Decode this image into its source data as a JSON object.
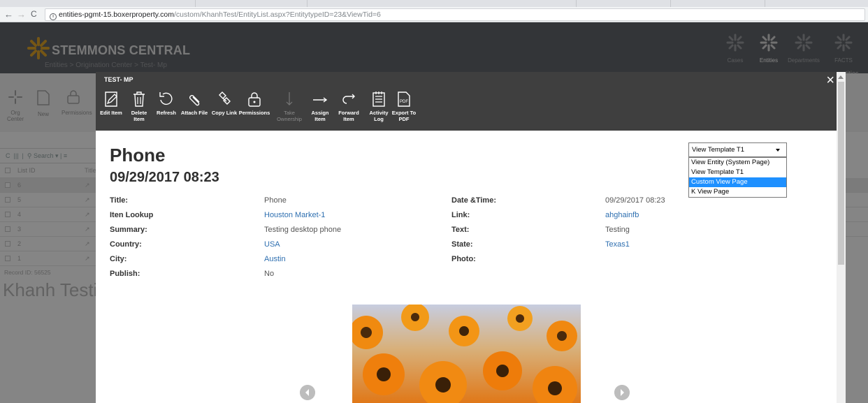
{
  "browser": {
    "url_host": "entities-pgmt-15.boxerproperty.com",
    "url_path": "/custom/KhanhTest/EntityList.aspx?EntitytypeID=23&ViewTid=6"
  },
  "app": {
    "brand": "STEMMONS CENTRAL",
    "breadcrumb": [
      "Entities",
      "Origination Center",
      "Test- Mp"
    ],
    "header_icons": [
      "Cases",
      "Entities",
      "Departments",
      "FACTS"
    ],
    "toolbar": [
      "Org Center",
      "New",
      "Permissions"
    ],
    "list_header": [
      "List ID",
      "Title"
    ],
    "list_search": "Search",
    "rows": [
      "6",
      "5",
      "4",
      "3",
      "2",
      "1"
    ],
    "record_id": "Record ID: 56525",
    "page_title": "Khanh Testi",
    "right_tab": "tities"
  },
  "modal": {
    "title": "TEST- MP",
    "buttons": [
      {
        "icon": "edit-icon",
        "label": "Edit Item"
      },
      {
        "icon": "trash-icon",
        "label": "Delete Item"
      },
      {
        "icon": "refresh-icon",
        "label": "Refresh"
      },
      {
        "icon": "paperclip-icon",
        "label": "Attach File"
      },
      {
        "icon": "link-icon",
        "label": "Copy Link"
      },
      {
        "icon": "lock-icon",
        "label": "Permissions"
      },
      {
        "icon": "arrow-down-icon",
        "label": "Take Ownership",
        "disabled": true
      },
      {
        "icon": "arrow-right-icon",
        "label": "Assign Item"
      },
      {
        "icon": "forward-icon",
        "label": "Forward Item"
      },
      {
        "icon": "log-icon",
        "label": "Activity Log"
      },
      {
        "icon": "pdf-icon",
        "label": "Export To PDF"
      }
    ],
    "record_title": "Phone",
    "record_date": "09/29/2017 08:23",
    "fields_left": [
      {
        "label": "Title:",
        "value": "Phone",
        "link": false
      },
      {
        "label": "Iten Lookup",
        "value": "Houston Market-1",
        "link": true
      },
      {
        "label": "Summary:",
        "value": "Testing desktop phone",
        "link": false
      },
      {
        "label": "Country:",
        "value": "USA",
        "link": true
      },
      {
        "label": "City:",
        "value": "Austin",
        "link": true
      },
      {
        "label": "Publish:",
        "value": "No",
        "link": false
      }
    ],
    "fields_right": [
      {
        "label": "Date &Time:",
        "value": "09/29/2017 08:23",
        "link": false
      },
      {
        "label": "Link:",
        "value": "ahghainfb",
        "link": true
      },
      {
        "label": "Text:",
        "value": "Testing",
        "link": false
      },
      {
        "label": "State:",
        "value": "Texas1",
        "link": true
      },
      {
        "label": "Photo:",
        "value": "",
        "link": false
      }
    ],
    "view_select": {
      "value": "View Template T1",
      "options": [
        "View Entity (System Page)",
        "View Template T1",
        "Custom View Page",
        "K View Page"
      ],
      "highlighted": "Custom View Page"
    },
    "close_symbol": "×"
  },
  "colors": {
    "header_bg": "#63666b",
    "modal_toolbar": "#3f3f3f",
    "link": "#2e6fb0",
    "dropdown_highlight": "#1e90ff"
  }
}
